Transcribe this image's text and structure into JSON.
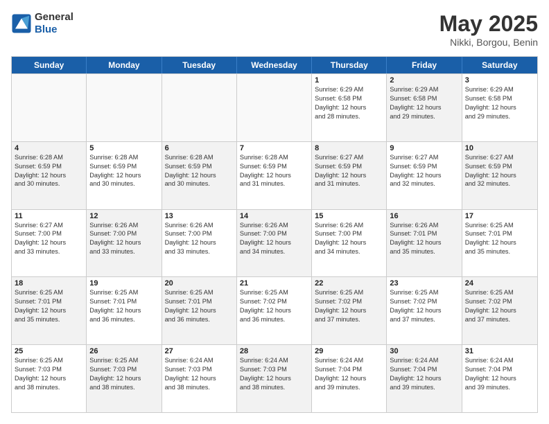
{
  "header": {
    "logo_general": "General",
    "logo_blue": "Blue",
    "month_title": "May 2025",
    "location": "Nikki, Borgou, Benin"
  },
  "days_of_week": [
    "Sunday",
    "Monday",
    "Tuesday",
    "Wednesday",
    "Thursday",
    "Friday",
    "Saturday"
  ],
  "weeks": [
    [
      {
        "day": "",
        "info": "",
        "shaded": false,
        "empty": true
      },
      {
        "day": "",
        "info": "",
        "shaded": false,
        "empty": true
      },
      {
        "day": "",
        "info": "",
        "shaded": false,
        "empty": true
      },
      {
        "day": "",
        "info": "",
        "shaded": false,
        "empty": true
      },
      {
        "day": "1",
        "info": "Sunrise: 6:29 AM\nSunset: 6:58 PM\nDaylight: 12 hours\nand 28 minutes.",
        "shaded": false,
        "empty": false
      },
      {
        "day": "2",
        "info": "Sunrise: 6:29 AM\nSunset: 6:58 PM\nDaylight: 12 hours\nand 29 minutes.",
        "shaded": true,
        "empty": false
      },
      {
        "day": "3",
        "info": "Sunrise: 6:29 AM\nSunset: 6:58 PM\nDaylight: 12 hours\nand 29 minutes.",
        "shaded": false,
        "empty": false
      }
    ],
    [
      {
        "day": "4",
        "info": "Sunrise: 6:28 AM\nSunset: 6:59 PM\nDaylight: 12 hours\nand 30 minutes.",
        "shaded": true,
        "empty": false
      },
      {
        "day": "5",
        "info": "Sunrise: 6:28 AM\nSunset: 6:59 PM\nDaylight: 12 hours\nand 30 minutes.",
        "shaded": false,
        "empty": false
      },
      {
        "day": "6",
        "info": "Sunrise: 6:28 AM\nSunset: 6:59 PM\nDaylight: 12 hours\nand 30 minutes.",
        "shaded": true,
        "empty": false
      },
      {
        "day": "7",
        "info": "Sunrise: 6:28 AM\nSunset: 6:59 PM\nDaylight: 12 hours\nand 31 minutes.",
        "shaded": false,
        "empty": false
      },
      {
        "day": "8",
        "info": "Sunrise: 6:27 AM\nSunset: 6:59 PM\nDaylight: 12 hours\nand 31 minutes.",
        "shaded": true,
        "empty": false
      },
      {
        "day": "9",
        "info": "Sunrise: 6:27 AM\nSunset: 6:59 PM\nDaylight: 12 hours\nand 32 minutes.",
        "shaded": false,
        "empty": false
      },
      {
        "day": "10",
        "info": "Sunrise: 6:27 AM\nSunset: 6:59 PM\nDaylight: 12 hours\nand 32 minutes.",
        "shaded": true,
        "empty": false
      }
    ],
    [
      {
        "day": "11",
        "info": "Sunrise: 6:27 AM\nSunset: 7:00 PM\nDaylight: 12 hours\nand 33 minutes.",
        "shaded": false,
        "empty": false
      },
      {
        "day": "12",
        "info": "Sunrise: 6:26 AM\nSunset: 7:00 PM\nDaylight: 12 hours\nand 33 minutes.",
        "shaded": true,
        "empty": false
      },
      {
        "day": "13",
        "info": "Sunrise: 6:26 AM\nSunset: 7:00 PM\nDaylight: 12 hours\nand 33 minutes.",
        "shaded": false,
        "empty": false
      },
      {
        "day": "14",
        "info": "Sunrise: 6:26 AM\nSunset: 7:00 PM\nDaylight: 12 hours\nand 34 minutes.",
        "shaded": true,
        "empty": false
      },
      {
        "day": "15",
        "info": "Sunrise: 6:26 AM\nSunset: 7:00 PM\nDaylight: 12 hours\nand 34 minutes.",
        "shaded": false,
        "empty": false
      },
      {
        "day": "16",
        "info": "Sunrise: 6:26 AM\nSunset: 7:01 PM\nDaylight: 12 hours\nand 35 minutes.",
        "shaded": true,
        "empty": false
      },
      {
        "day": "17",
        "info": "Sunrise: 6:25 AM\nSunset: 7:01 PM\nDaylight: 12 hours\nand 35 minutes.",
        "shaded": false,
        "empty": false
      }
    ],
    [
      {
        "day": "18",
        "info": "Sunrise: 6:25 AM\nSunset: 7:01 PM\nDaylight: 12 hours\nand 35 minutes.",
        "shaded": true,
        "empty": false
      },
      {
        "day": "19",
        "info": "Sunrise: 6:25 AM\nSunset: 7:01 PM\nDaylight: 12 hours\nand 36 minutes.",
        "shaded": false,
        "empty": false
      },
      {
        "day": "20",
        "info": "Sunrise: 6:25 AM\nSunset: 7:01 PM\nDaylight: 12 hours\nand 36 minutes.",
        "shaded": true,
        "empty": false
      },
      {
        "day": "21",
        "info": "Sunrise: 6:25 AM\nSunset: 7:02 PM\nDaylight: 12 hours\nand 36 minutes.",
        "shaded": false,
        "empty": false
      },
      {
        "day": "22",
        "info": "Sunrise: 6:25 AM\nSunset: 7:02 PM\nDaylight: 12 hours\nand 37 minutes.",
        "shaded": true,
        "empty": false
      },
      {
        "day": "23",
        "info": "Sunrise: 6:25 AM\nSunset: 7:02 PM\nDaylight: 12 hours\nand 37 minutes.",
        "shaded": false,
        "empty": false
      },
      {
        "day": "24",
        "info": "Sunrise: 6:25 AM\nSunset: 7:02 PM\nDaylight: 12 hours\nand 37 minutes.",
        "shaded": true,
        "empty": false
      }
    ],
    [
      {
        "day": "25",
        "info": "Sunrise: 6:25 AM\nSunset: 7:03 PM\nDaylight: 12 hours\nand 38 minutes.",
        "shaded": false,
        "empty": false
      },
      {
        "day": "26",
        "info": "Sunrise: 6:25 AM\nSunset: 7:03 PM\nDaylight: 12 hours\nand 38 minutes.",
        "shaded": true,
        "empty": false
      },
      {
        "day": "27",
        "info": "Sunrise: 6:24 AM\nSunset: 7:03 PM\nDaylight: 12 hours\nand 38 minutes.",
        "shaded": false,
        "empty": false
      },
      {
        "day": "28",
        "info": "Sunrise: 6:24 AM\nSunset: 7:03 PM\nDaylight: 12 hours\nand 38 minutes.",
        "shaded": true,
        "empty": false
      },
      {
        "day": "29",
        "info": "Sunrise: 6:24 AM\nSunset: 7:04 PM\nDaylight: 12 hours\nand 39 minutes.",
        "shaded": false,
        "empty": false
      },
      {
        "day": "30",
        "info": "Sunrise: 6:24 AM\nSunset: 7:04 PM\nDaylight: 12 hours\nand 39 minutes.",
        "shaded": true,
        "empty": false
      },
      {
        "day": "31",
        "info": "Sunrise: 6:24 AM\nSunset: 7:04 PM\nDaylight: 12 hours\nand 39 minutes.",
        "shaded": false,
        "empty": false
      }
    ]
  ]
}
